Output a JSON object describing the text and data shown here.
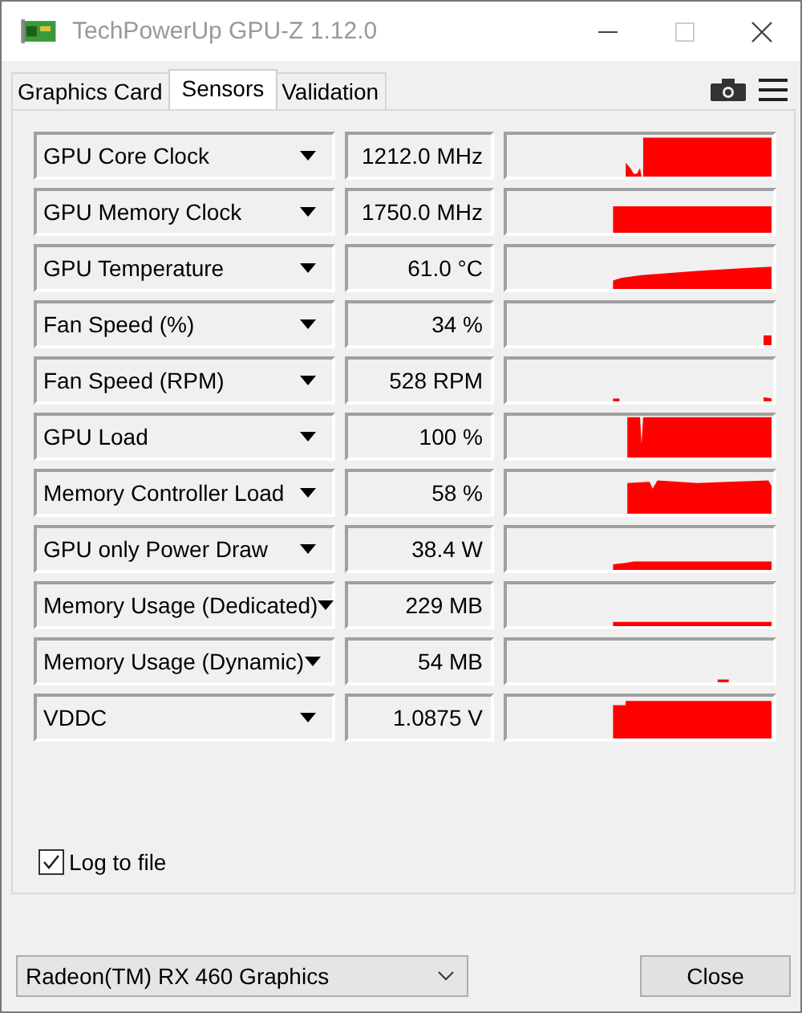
{
  "window": {
    "title": "TechPowerUp GPU-Z 1.12.0"
  },
  "tabs": [
    {
      "label": "Graphics Card",
      "selected": false
    },
    {
      "label": "Sensors",
      "selected": true
    },
    {
      "label": "Validation",
      "selected": false
    }
  ],
  "sensors": [
    {
      "name": "GPU Core Clock",
      "value": "1212.0 MHz"
    },
    {
      "name": "GPU Memory Clock",
      "value": "1750.0 MHz"
    },
    {
      "name": "GPU Temperature",
      "value": "61.0 °C"
    },
    {
      "name": "Fan Speed (%)",
      "value": "34 %"
    },
    {
      "name": "Fan Speed (RPM)",
      "value": "528 RPM"
    },
    {
      "name": "GPU Load",
      "value": "100 %"
    },
    {
      "name": "Memory Controller Load",
      "value": "58 %"
    },
    {
      "name": "GPU only Power Draw",
      "value": "38.4 W"
    },
    {
      "name": "Memory Usage (Dedicated)",
      "value": "229 MB"
    },
    {
      "name": "Memory Usage (Dynamic)",
      "value": "54 MB"
    },
    {
      "name": "VDDC",
      "value": "1.0875 V"
    }
  ],
  "log_to_file": {
    "label": "Log to file",
    "checked": true
  },
  "device_select": {
    "value": "Radeon(TM) RX 460 Graphics"
  },
  "close_button": {
    "label": "Close"
  }
}
